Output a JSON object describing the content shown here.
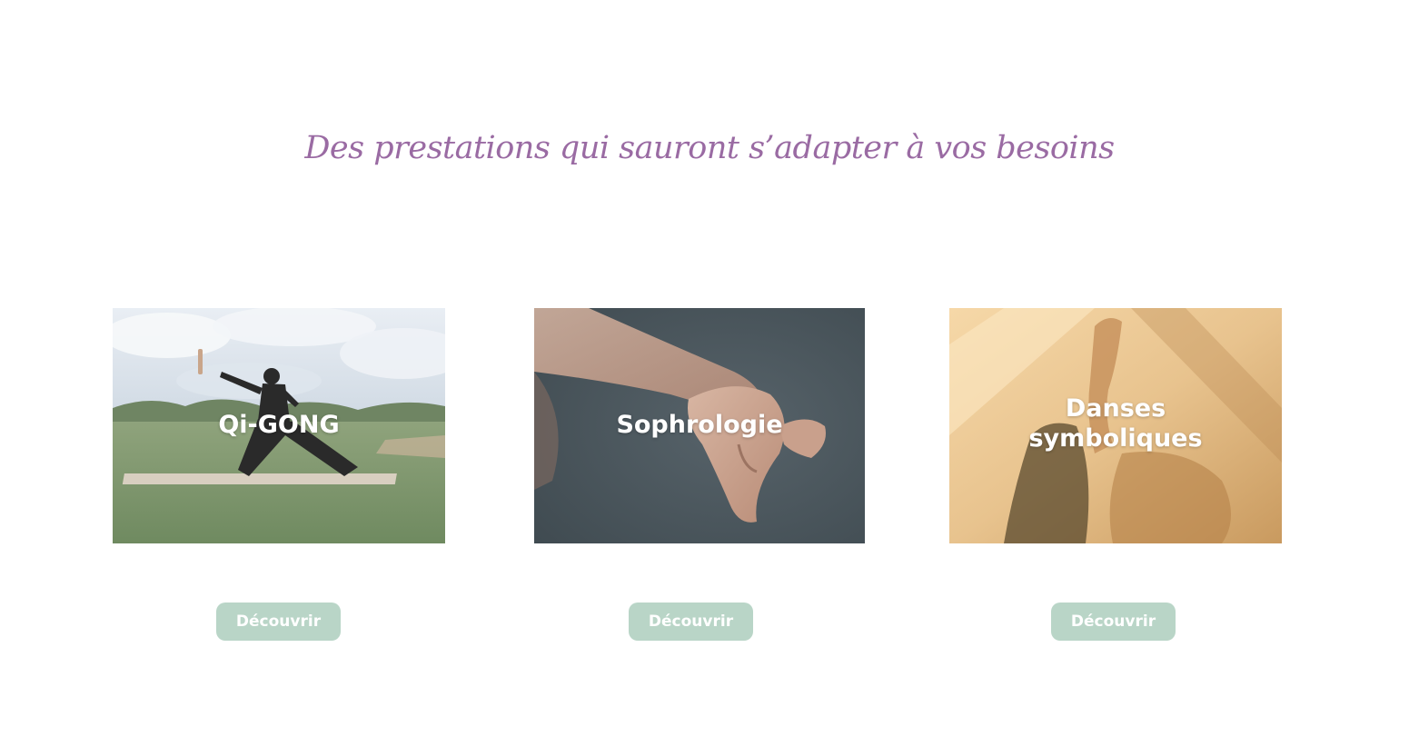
{
  "section": {
    "title": "Des prestations qui sauront s’adapter à vos besoins"
  },
  "cards": [
    {
      "label": "Qi-GONG",
      "button": "Découvrir"
    },
    {
      "label_line1": "Sophrologie",
      "button": "Découvrir"
    },
    {
      "label_line1": "Danses",
      "label_line2": "symboliques",
      "button": "Découvrir"
    }
  ],
  "colors": {
    "title": "#9a6ba3",
    "button_bg": "#b9d5c7",
    "button_text": "#ffffff"
  }
}
